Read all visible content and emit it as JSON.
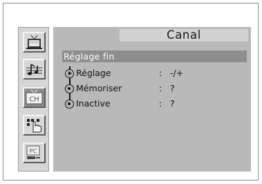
{
  "sidebar": {
    "items": [
      {
        "name": "picture",
        "icon": "tv-picture-icon",
        "active": false
      },
      {
        "name": "sound",
        "icon": "music-note-icon",
        "active": false
      },
      {
        "name": "channel",
        "icon": "channel-tv-icon",
        "label": "CH",
        "active": true
      },
      {
        "name": "setup",
        "icon": "hand-pointer-icon",
        "active": false
      },
      {
        "name": "pc",
        "icon": "pc-icon",
        "label": "PC",
        "active": false
      }
    ]
  },
  "panel": {
    "title": "Canal",
    "submenu_title": "Réglage fin",
    "rows": [
      {
        "label": "Réglage",
        "colon": ":",
        "value": "-/+",
        "bullet": "play"
      },
      {
        "label": "Mémoriser",
        "colon": ":",
        "value": "?",
        "bullet": "dot"
      },
      {
        "label": "Inactive",
        "colon": ":",
        "value": "?",
        "bullet": "dot"
      }
    ]
  },
  "colors": {
    "panel_bg": "#b9b9b9",
    "title_bar": "#d2d2d2",
    "submenu_bar": "#8e8e8e",
    "sidebar_bg": "#d6d6d6",
    "active_tab": "#8c8c8c"
  }
}
